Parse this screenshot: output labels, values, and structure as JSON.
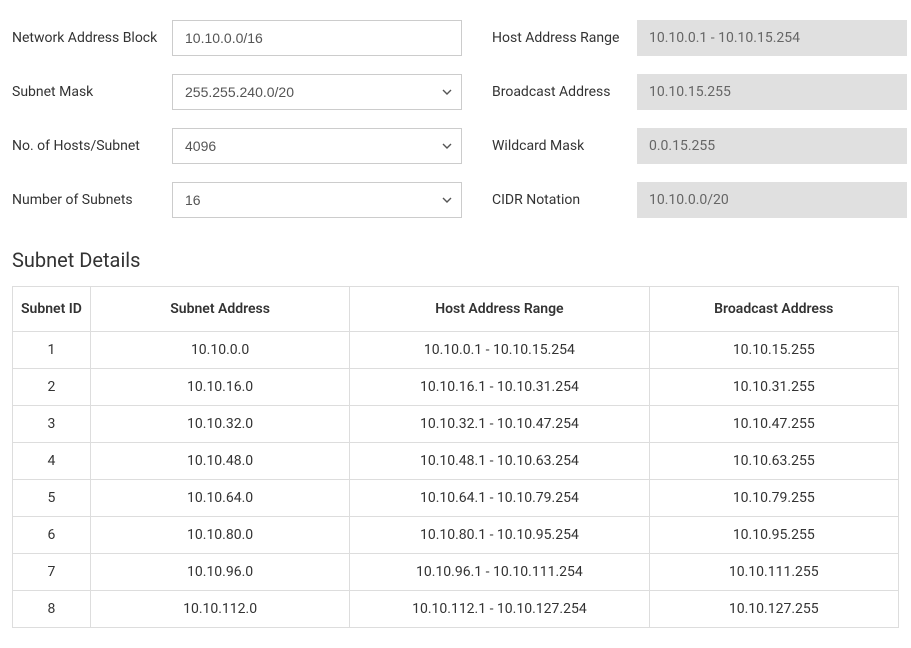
{
  "form": {
    "networkAddressBlock": {
      "label": "Network Address Block",
      "value": "10.10.0.0/16"
    },
    "subnetMask": {
      "label": "Subnet Mask",
      "value": "255.255.240.0/20"
    },
    "hostsPerSubnet": {
      "label": "No. of Hosts/Subnet",
      "value": "4096"
    },
    "numberOfSubnets": {
      "label": "Number of Subnets",
      "value": "16"
    },
    "hostAddressRange": {
      "label": "Host Address Range",
      "value": "10.10.0.1 - 10.10.15.254"
    },
    "broadcastAddress": {
      "label": "Broadcast Address",
      "value": "10.10.15.255"
    },
    "wildcardMask": {
      "label": "Wildcard Mask",
      "value": "0.0.15.255"
    },
    "cidrNotation": {
      "label": "CIDR Notation",
      "value": "10.10.0.0/20"
    }
  },
  "sectionTitle": "Subnet Details",
  "table": {
    "headers": {
      "id": "Subnet ID",
      "address": "Subnet Address",
      "range": "Host Address Range",
      "broadcast": "Broadcast Address"
    },
    "rows": [
      {
        "id": "1",
        "address": "10.10.0.0",
        "range": "10.10.0.1 - 10.10.15.254",
        "broadcast": "10.10.15.255"
      },
      {
        "id": "2",
        "address": "10.10.16.0",
        "range": "10.10.16.1 - 10.10.31.254",
        "broadcast": "10.10.31.255"
      },
      {
        "id": "3",
        "address": "10.10.32.0",
        "range": "10.10.32.1 - 10.10.47.254",
        "broadcast": "10.10.47.255"
      },
      {
        "id": "4",
        "address": "10.10.48.0",
        "range": "10.10.48.1 - 10.10.63.254",
        "broadcast": "10.10.63.255"
      },
      {
        "id": "5",
        "address": "10.10.64.0",
        "range": "10.10.64.1 - 10.10.79.254",
        "broadcast": "10.10.79.255"
      },
      {
        "id": "6",
        "address": "10.10.80.0",
        "range": "10.10.80.1 - 10.10.95.254",
        "broadcast": "10.10.95.255"
      },
      {
        "id": "7",
        "address": "10.10.96.0",
        "range": "10.10.96.1 - 10.10.111.254",
        "broadcast": "10.10.111.255"
      },
      {
        "id": "8",
        "address": "10.10.112.0",
        "range": "10.10.112.1 - 10.10.127.254",
        "broadcast": "10.10.127.255"
      }
    ]
  }
}
